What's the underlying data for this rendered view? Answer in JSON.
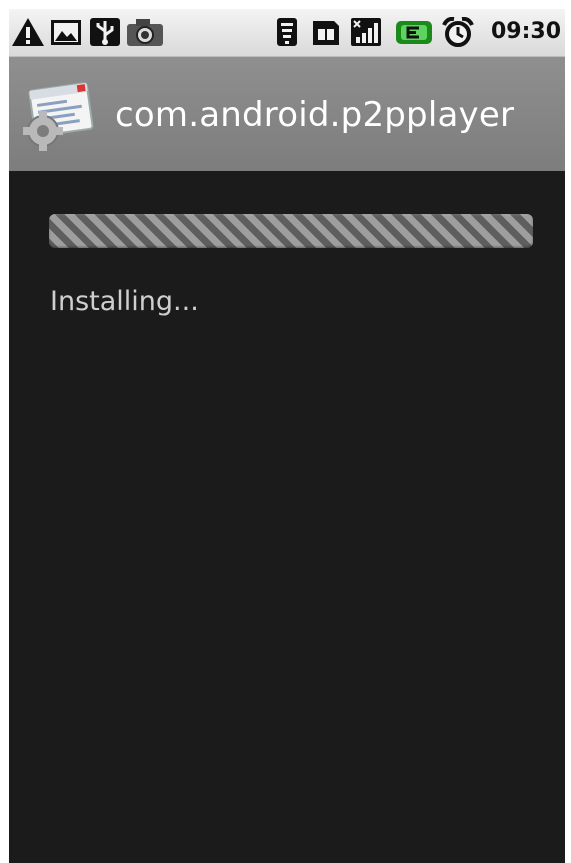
{
  "status_bar": {
    "time": "09:30",
    "icons": [
      "warning-icon",
      "image-icon",
      "usb-icon",
      "camera-icon",
      "wifi-icon",
      "sim-icon",
      "signal-icon",
      "battery-icon",
      "alarm-icon"
    ]
  },
  "title_bar": {
    "app_name": "com.android.p2pplayer",
    "icon": "package-installer-icon"
  },
  "install": {
    "status": "Installing...",
    "progress": "indeterminate"
  }
}
